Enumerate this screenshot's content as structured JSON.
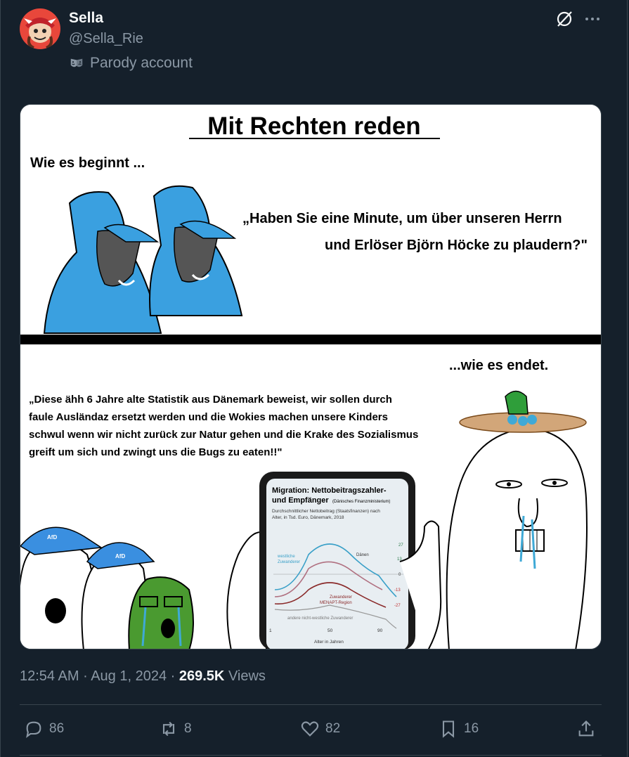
{
  "author": {
    "name": "Sella",
    "handle": "@Sella_Rie",
    "label": "Parody account"
  },
  "icons": {
    "grok": "grok-icon",
    "more": "more-icon",
    "parody": "parody-mask-icon",
    "reply": "reply-icon",
    "repost": "repost-icon",
    "like": "heart-icon",
    "bookmark": "bookmark-icon",
    "share": "share-icon"
  },
  "meme": {
    "title": "Mit Rechten reden",
    "top_caption": "Wie es beginnt ...",
    "quote_top_line1": "„Haben Sie eine Minute, um über unseren Herrn",
    "quote_top_line2": "und Erlöser Björn Höcke zu plaudern?\"",
    "bottom_caption": "...wie es endet.",
    "quote_bottom_line1": "„Diese ähh 6 Jahre alte Statistik aus Dänemark beweist, wir sollen durch",
    "quote_bottom_line2": "faule Ausländaz ersetzt werden und die Wokies machen unsere Kinders",
    "quote_bottom_line3": "schwul wenn wir nicht zurück zur Natur gehen und die Krake des Sozialismus",
    "quote_bottom_line4": "greift um sich und zwingt uns die Bugs zu eaten!!\"",
    "cap_logo": "AfD",
    "phone": {
      "title_line1": "Migration: Nettobeitragszahler-",
      "title_line2": "und Empfänger",
      "title_source": "(Dänisches Finanzministerium)",
      "subtitle_line1": "Durchschnittlicher Nettobeitrag (Staatsfinanzen) nach",
      "subtitle_line2": "Alter, in Tsd. Euro, Dänemark, 2018",
      "label_western": "westliche",
      "label_western2": "Zuwanderer",
      "label_danes": "Dänen",
      "label_menapt1": "Zuwanderer",
      "label_menapt2": "MENAPT-Region",
      "label_other": "andere nicht-westliche Zuwanderer",
      "xlabel": "Alter in Jahren",
      "tick_1": "1",
      "tick_50": "50",
      "tick_90": "90",
      "ytick_27": "27",
      "ytick_13": "13",
      "ytick_0": "0",
      "ytick_m13": "-13",
      "ytick_m27": "-27"
    }
  },
  "meta": {
    "time": "12:54 AM",
    "sep1": "·",
    "date": "Aug 1, 2024",
    "sep2": "·",
    "views_count": "269.5K",
    "views_label": "Views"
  },
  "actions": {
    "replies": "86",
    "reposts": "8",
    "likes": "82",
    "bookmarks": "16"
  }
}
